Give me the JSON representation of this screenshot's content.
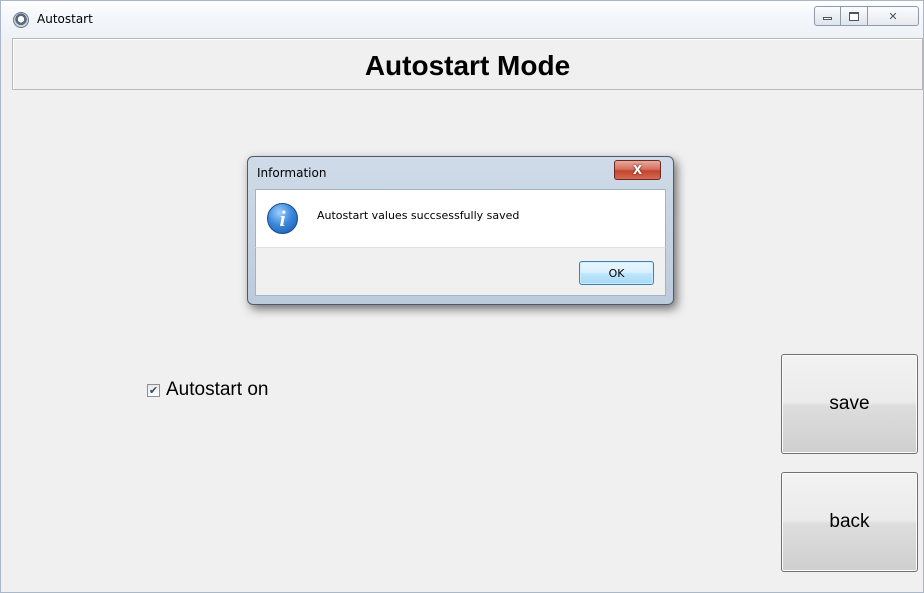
{
  "window": {
    "title": "Autostart",
    "controls": {
      "minimize": "",
      "maximize": "",
      "close": "✕"
    }
  },
  "header": {
    "title": "Autostart Mode"
  },
  "form": {
    "autostart_checkbox": {
      "label": "Autostart on",
      "checked": true,
      "check_glyph": "✔"
    }
  },
  "buttons": {
    "save": "save",
    "back": "back"
  },
  "dialog": {
    "title": "Information",
    "close_glyph": "X",
    "icon_glyph": "i",
    "message": "Autostart values succsessfully saved",
    "ok_label": "OK"
  }
}
